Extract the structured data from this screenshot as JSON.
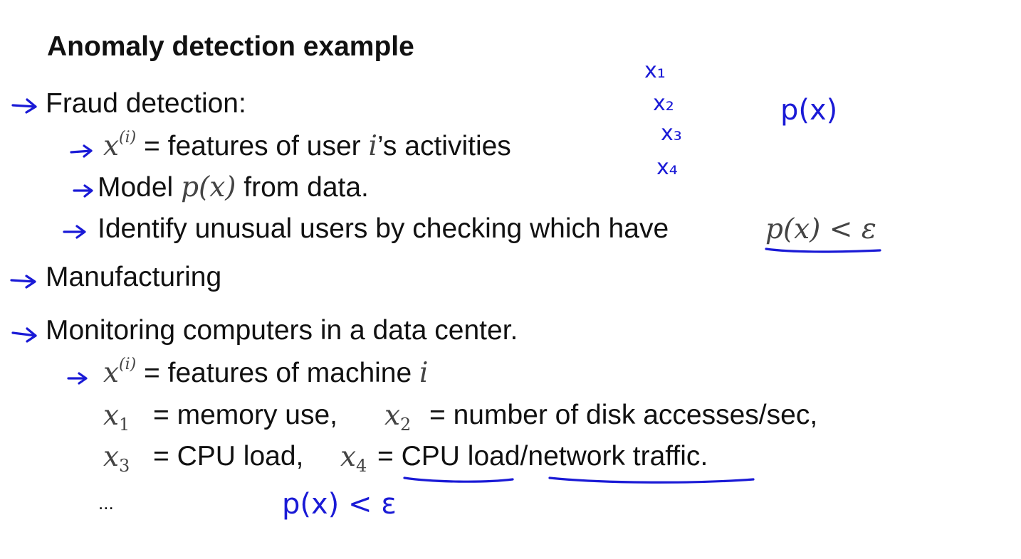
{
  "slide": {
    "title": "Anomaly detection example",
    "items": [
      {
        "label": "Fraud detection:"
      },
      {
        "label": "Manufacturing"
      },
      {
        "label": "Monitoring computers in a data center."
      }
    ],
    "fraud": {
      "sub1_var": "x",
      "sub1_sup": "(i)",
      "sub1_text": " = features of user ",
      "sub1_i": "i",
      "sub1_tail": "’s activities",
      "sub2_text": "Model ",
      "sub2_math": "p(x)",
      "sub2_tail": " from data.",
      "sub3_text": "Identify unusual users by checking which have",
      "sub3_math": "p(x) < ε"
    },
    "monitor": {
      "sub1_var": "x",
      "sub1_sup": "(i)",
      "sub1_text": " = features of machine ",
      "sub1_i": "i",
      "x1": "x",
      "x1_sub": "1",
      "x1_text": "= memory use,",
      "x2": "x",
      "x2_sub": "2",
      "x2_text": "= number of disk accesses/sec,",
      "x3": "x",
      "x3_sub": "3",
      "x3_text": "= CPU load,",
      "x4": "x",
      "x4_sub": "4",
      "x4_eq": "=",
      "x4_part1": "CPU load",
      "x4_slash": "/",
      "x4_part2": "network traffic",
      "x4_end": ".",
      "ellipsis": "..."
    }
  },
  "handwriting": {
    "color": "#1a1ad6",
    "features": [
      "x₁",
      "x₂",
      "x₃",
      "x₄"
    ],
    "px_note": "p(x)",
    "bottom_note": "p(x) < ε"
  }
}
